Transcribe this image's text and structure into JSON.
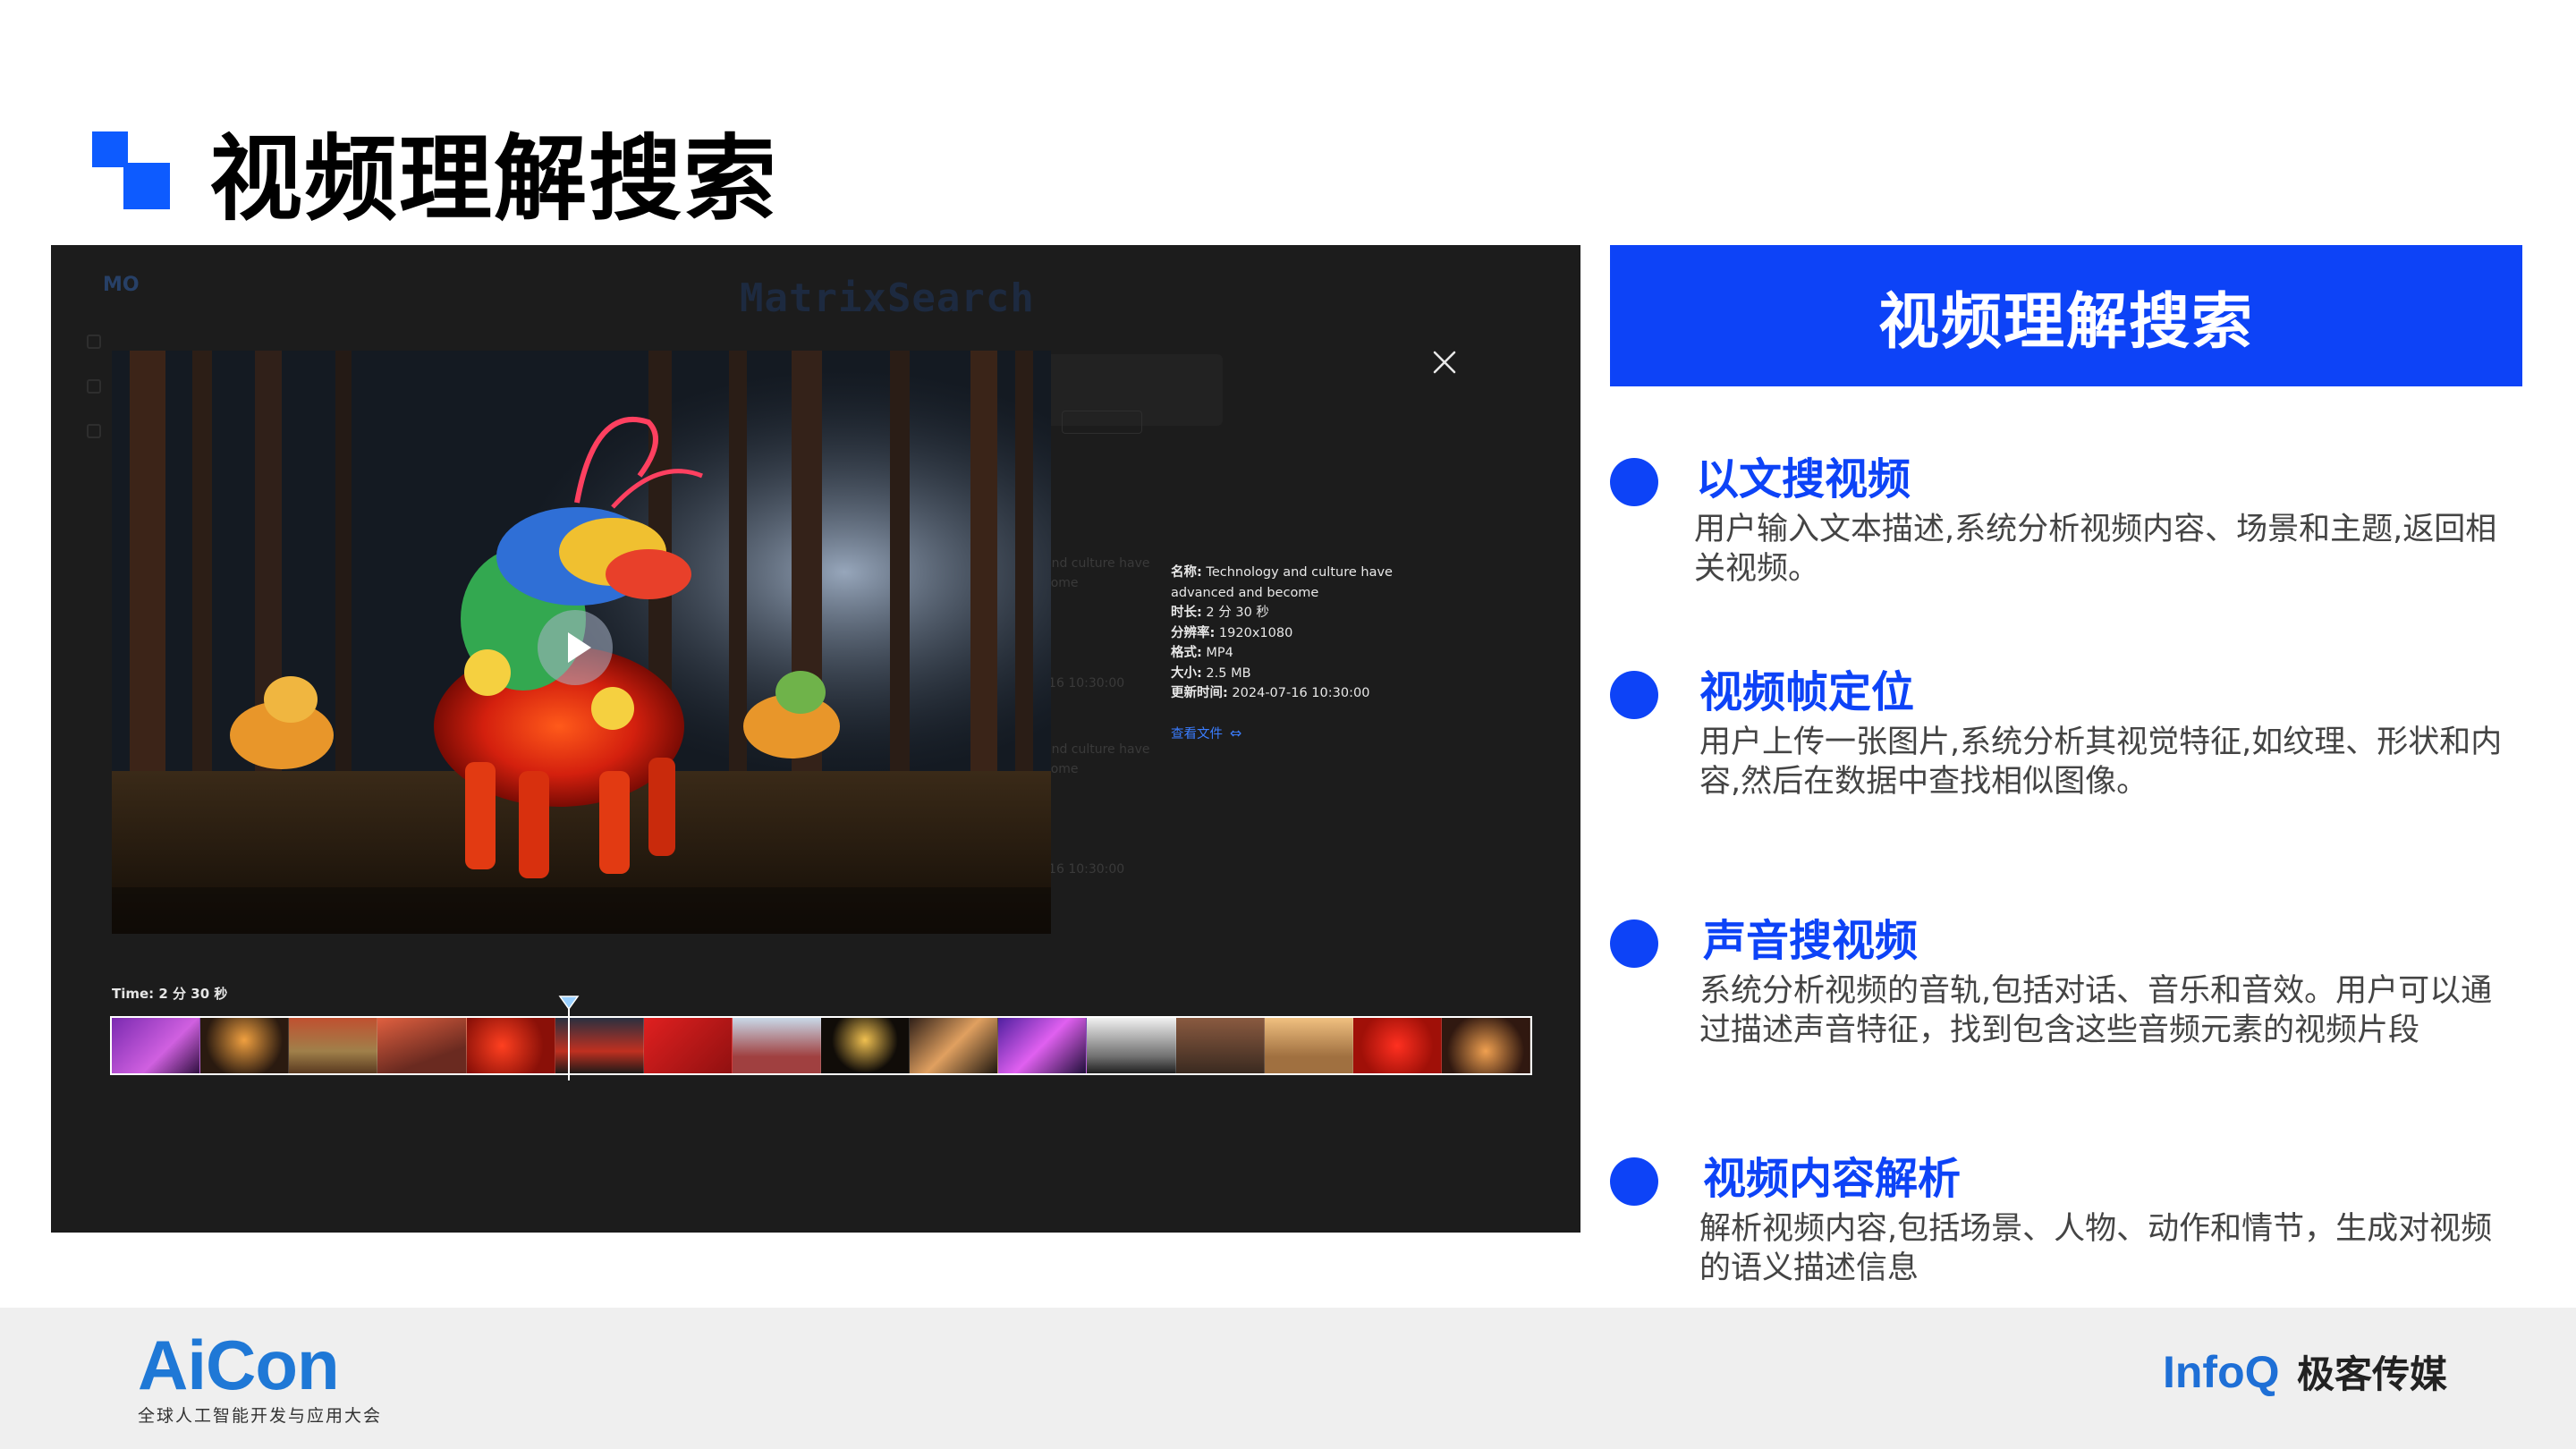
{
  "slide": {
    "title": "视频理解搜索",
    "banner": "视频理解搜索"
  },
  "screenshot": {
    "brand": "MatrixSearch",
    "logo": "MO",
    "info": {
      "name_label": "名称:",
      "name_value": "Technology and culture have advanced and become",
      "duration_label": "时长:",
      "duration_value": "2 分 30 秒",
      "resolution_label": "分辨率:",
      "resolution_value": "1920x1080",
      "format_label": "格式:",
      "format_value": "MP4",
      "size_label": "大小:",
      "size_value": "2.5 MB",
      "updated_label": "更新时间:",
      "updated_value": "2024-07-16 10:30:00",
      "open_file": "查看文件"
    },
    "time_label": "Time: 2 分 30 秒",
    "ghost_rows": [
      "and culture have",
      "come",
      "-16 10:30:00",
      "and culture have",
      "come",
      "-16 10:30:00"
    ],
    "icons": [
      "close-icon",
      "play-icon",
      "link-icon",
      "playhead-marker-icon"
    ],
    "accent": "#3b7dff"
  },
  "features": [
    {
      "title": "以文搜视频",
      "desc": "用户输入文本描述,系统分析视频内容、场景和主题,返回相关视频。"
    },
    {
      "title": "视频帧定位",
      "desc": "用户上传一张图片,系统分析其视觉特征,如纹理、形状和内容,然后在数据中查找相似图像。"
    },
    {
      "title": "声音搜视频",
      "desc": "系统分析视频的音轨,包括对话、音乐和音效。用户可以通过描述声音特征，找到包含这些音频元素的视频片段"
    },
    {
      "title": "视频内容解析",
      "desc": "解析视频内容,包括场景、人物、动作和情节，生成对视频的语义描述信息"
    }
  ],
  "footer": {
    "aicon": "AiCon",
    "aicon_sub": "全球人工智能开发与应用大会",
    "infoq": "InfoQ",
    "geek": "极客传媒"
  },
  "colors": {
    "brand_blue": "#0d43f7",
    "title_mark": "#0d5bff",
    "panel_bg": "#1c1c1c"
  }
}
